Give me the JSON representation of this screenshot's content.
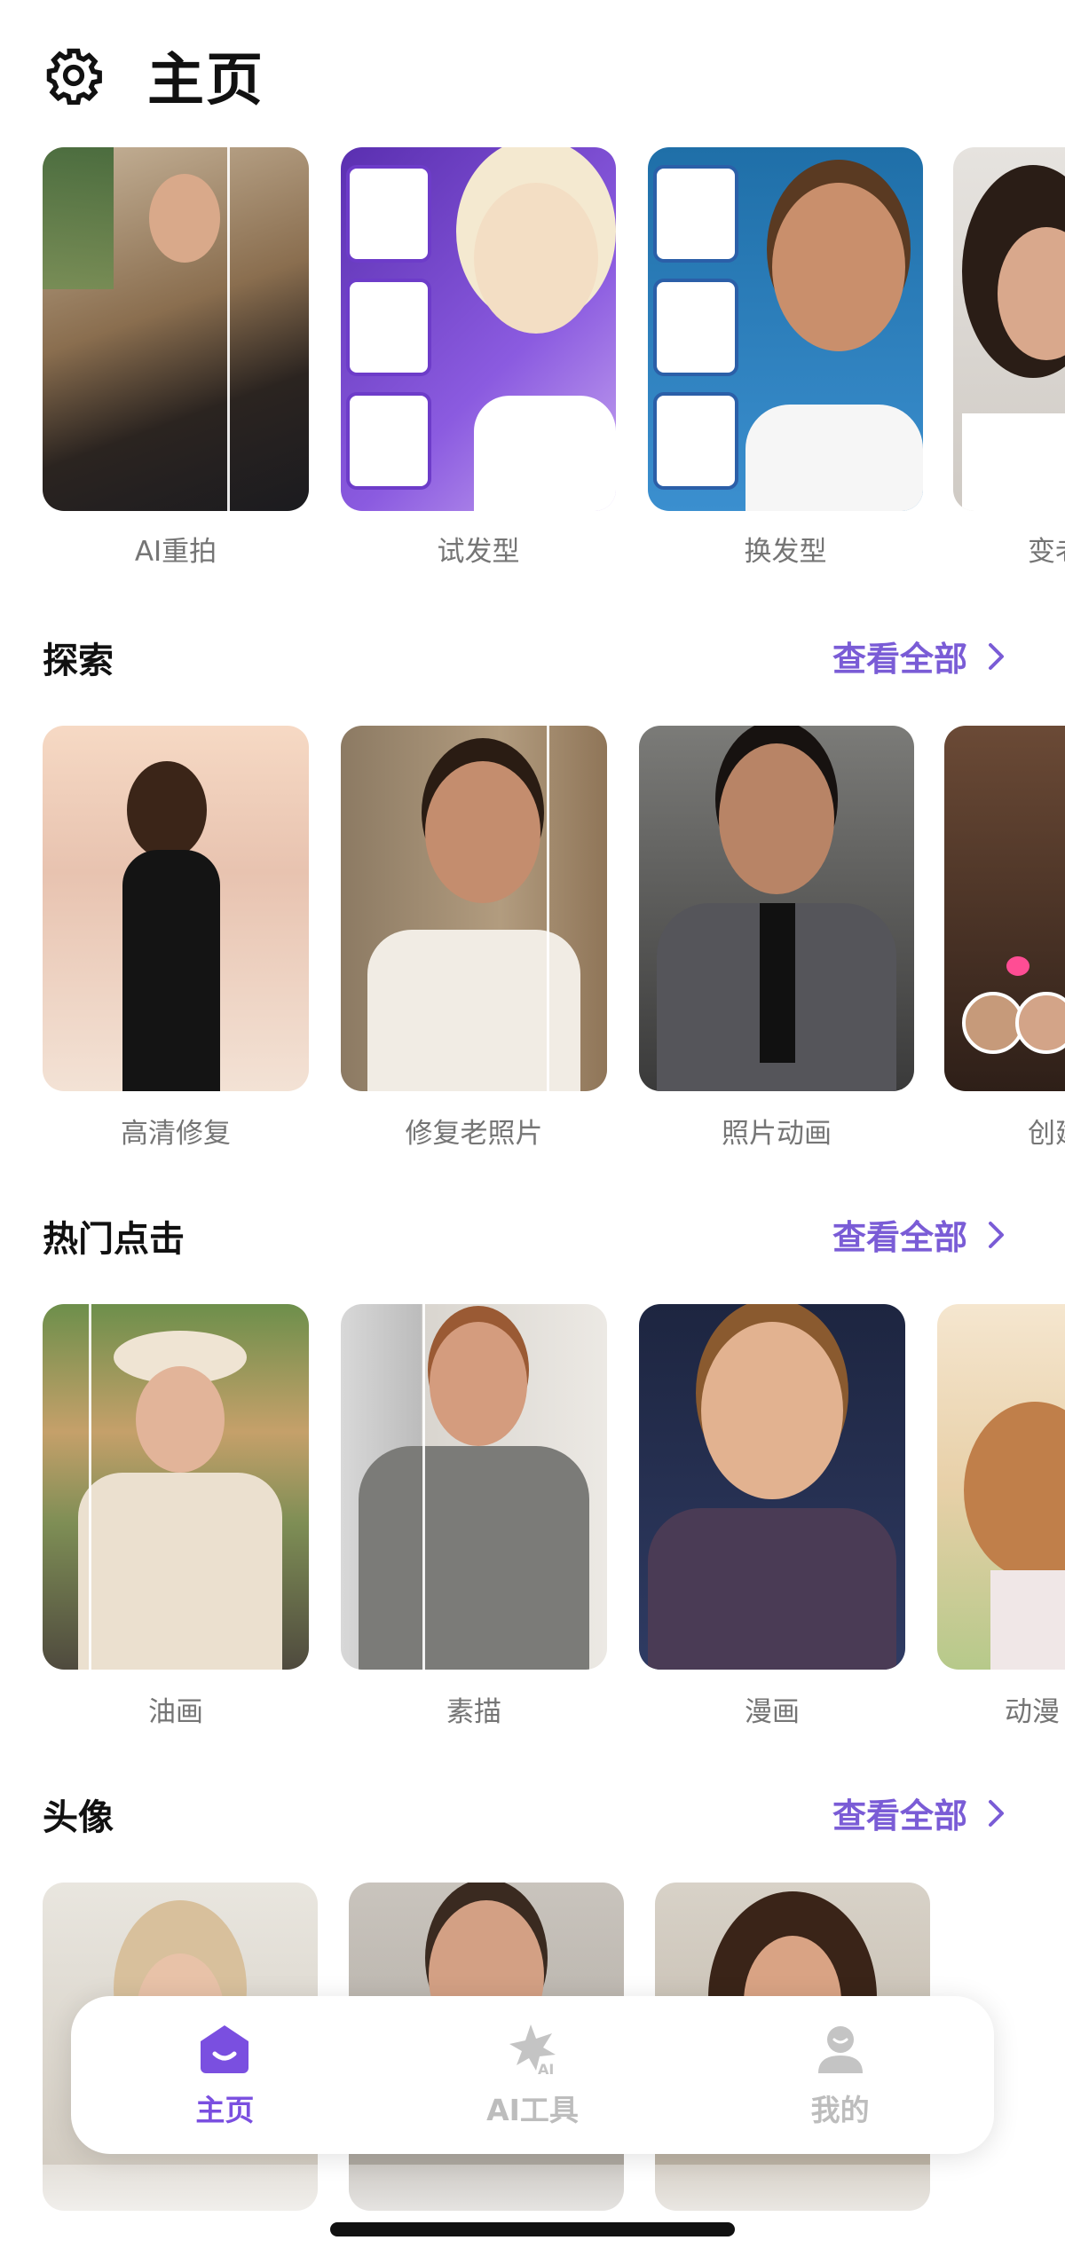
{
  "header": {
    "title": "主页",
    "settings_icon": "gear-icon"
  },
  "top_row": [
    {
      "label": "AI重拍"
    },
    {
      "label": "试发型"
    },
    {
      "label": "换发型"
    },
    {
      "label": "变老"
    }
  ],
  "explore": {
    "title": "探索",
    "view_all": "查看全部",
    "cards": [
      {
        "label": "高清修复"
      },
      {
        "label": "修复老照片"
      },
      {
        "label": "照片动画"
      },
      {
        "label": "创建约会"
      }
    ]
  },
  "hot": {
    "title": "热门点击",
    "view_all": "查看全部",
    "cards": [
      {
        "label": "油画"
      },
      {
        "label": "素描"
      },
      {
        "label": "漫画"
      },
      {
        "label": "动漫"
      }
    ]
  },
  "avatar": {
    "title": "头像",
    "view_all": "查看全部"
  },
  "nav": {
    "items": [
      {
        "label": "主页",
        "icon": "home-icon",
        "active": true
      },
      {
        "label": "AI工具",
        "icon": "ai-tools-icon",
        "active": false
      },
      {
        "label": "我的",
        "icon": "profile-icon",
        "active": false
      }
    ]
  },
  "colors": {
    "accent": "#7a4fe0",
    "link": "#7a5cd6"
  }
}
